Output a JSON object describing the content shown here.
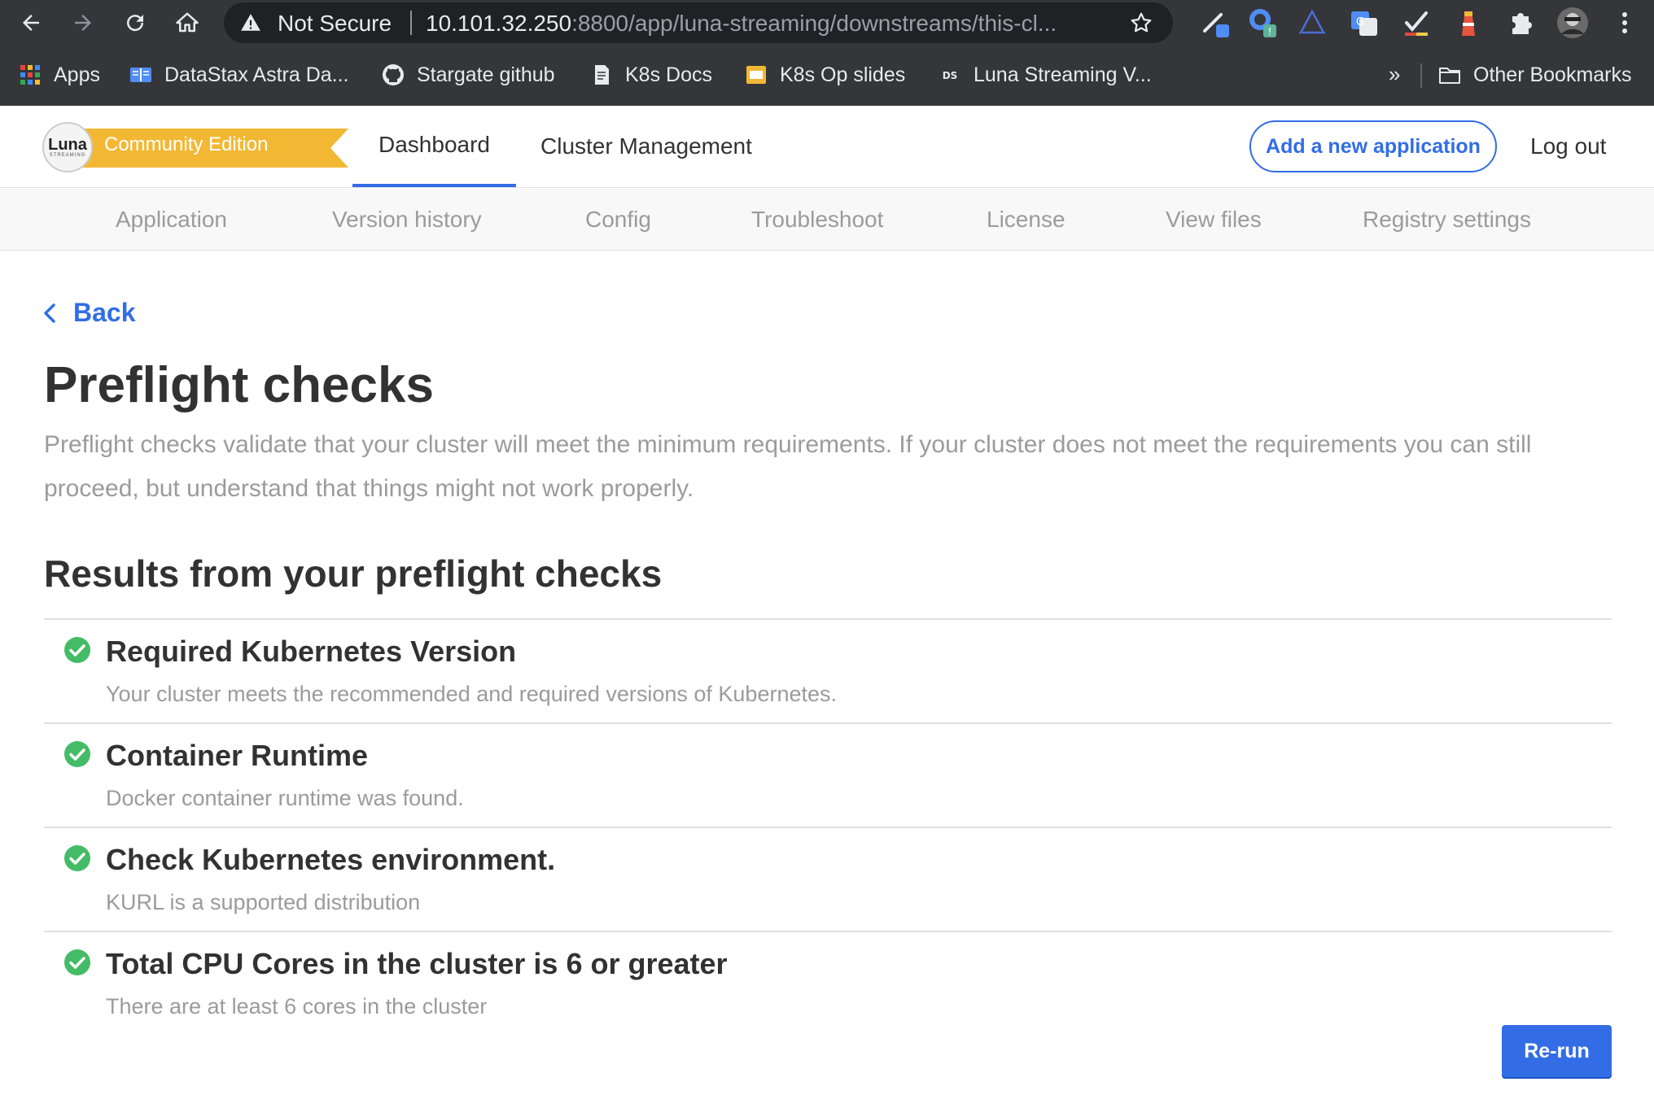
{
  "browser": {
    "security_label": "Not Secure",
    "url_host": "10.101.32.250",
    "url_path": ":8800/app/luna-streaming/downstreams/this-cl...",
    "bookmarks": [
      {
        "label": "Apps",
        "icon": "apps-grid-icon"
      },
      {
        "label": "DataStax Astra Da...",
        "icon": "book-icon"
      },
      {
        "label": "Stargate github",
        "icon": "github-icon"
      },
      {
        "label": "K8s Docs",
        "icon": "document-icon"
      },
      {
        "label": "K8s Op slides",
        "icon": "slides-icon"
      },
      {
        "label": "Luna Streaming V...",
        "icon": "ds-icon"
      }
    ],
    "more_bookmarks": "»",
    "other_bookmarks": "Other Bookmarks"
  },
  "header": {
    "logo_word": "Luna",
    "logo_sub": "STREAMING",
    "edition": "Community Edition",
    "tabs": [
      {
        "label": "Dashboard",
        "active": true
      },
      {
        "label": "Cluster Management",
        "active": false
      }
    ],
    "add_app": "Add a new application",
    "logout": "Log out"
  },
  "subnav": {
    "items": [
      "Application",
      "Version history",
      "Config",
      "Troubleshoot",
      "License",
      "View files",
      "Registry settings"
    ]
  },
  "main": {
    "back": "Back",
    "title": "Preflight checks",
    "description": "Preflight checks validate that your cluster will meet the minimum requirements. If your cluster does not meet the requirements you can still proceed, but understand that things might not work properly.",
    "results_title": "Results from your preflight checks",
    "results": [
      {
        "title": "Required Kubernetes Version",
        "message": "Your cluster meets the recommended and required versions of Kubernetes.",
        "status": "pass"
      },
      {
        "title": "Container Runtime",
        "message": "Docker container runtime was found.",
        "status": "pass"
      },
      {
        "title": "Check Kubernetes environment.",
        "message": "KURL is a supported distribution",
        "status": "pass"
      },
      {
        "title": "Total CPU Cores in the cluster is 6 or greater",
        "message": "There are at least 6 cores in the cluster",
        "status": "pass"
      }
    ],
    "rerun": "Re-run"
  },
  "colors": {
    "accent": "#326de6",
    "success": "#44bb66",
    "edition_ribbon": "#f2b834",
    "chrome_bg": "#35363a"
  }
}
